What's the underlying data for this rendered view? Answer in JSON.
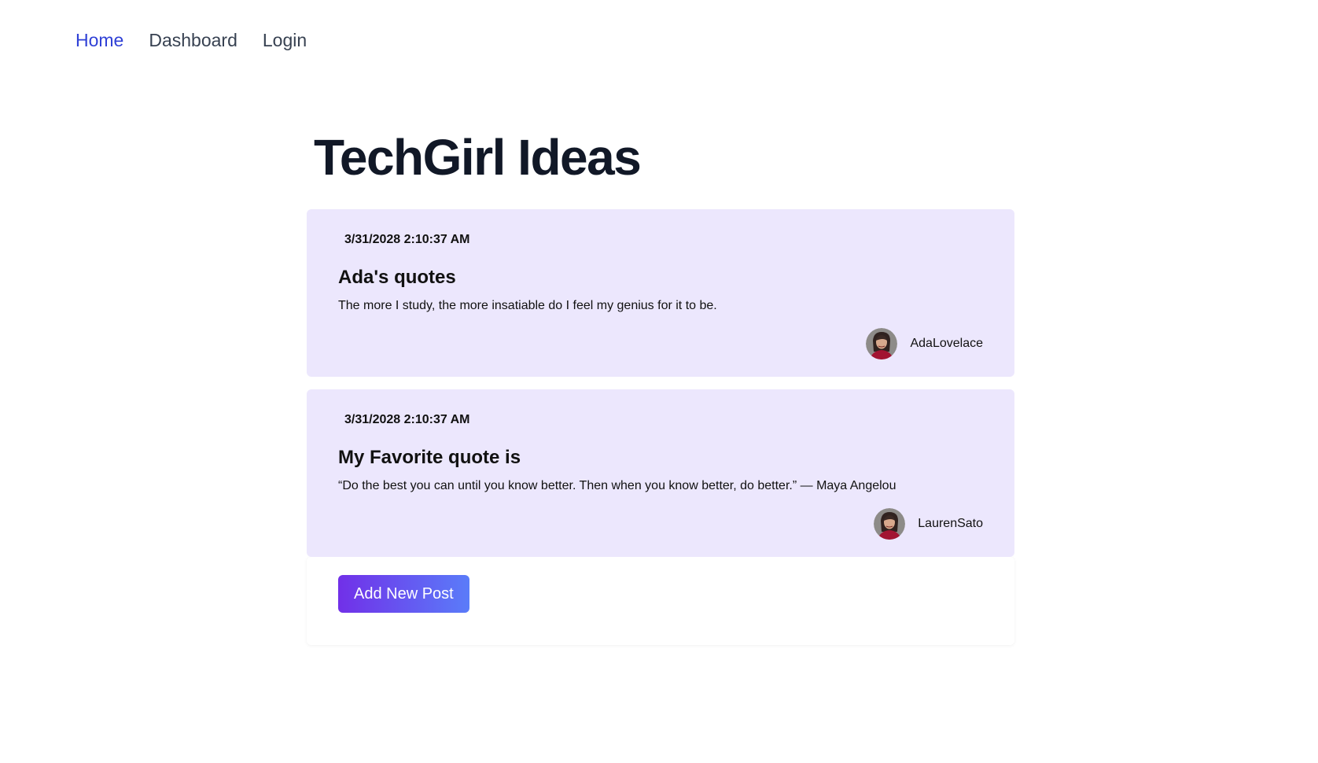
{
  "nav": {
    "home": "Home",
    "dashboard": "Dashboard",
    "login": "Login"
  },
  "page": {
    "title": "TechGirl Ideas"
  },
  "posts": [
    {
      "date": "3/31/2028 2:10:37 AM",
      "title": "Ada's quotes",
      "body": "The more I study, the more insatiable do I feel my genius for it to be.",
      "author": "AdaLovelace"
    },
    {
      "date": "3/31/2028 2:10:37 AM",
      "title": "My Favorite quote is",
      "body": "“Do the best you can until you know better. Then when you know better, do better.” — Maya Angelou",
      "author": "LaurenSato"
    }
  ],
  "actions": {
    "add_post": "Add New Post"
  },
  "colors": {
    "nav_active": "#2f40d6",
    "card_bg": "#ece7fd",
    "button_gradient_start": "#7130e8",
    "button_gradient_end": "#5a7cf9"
  }
}
